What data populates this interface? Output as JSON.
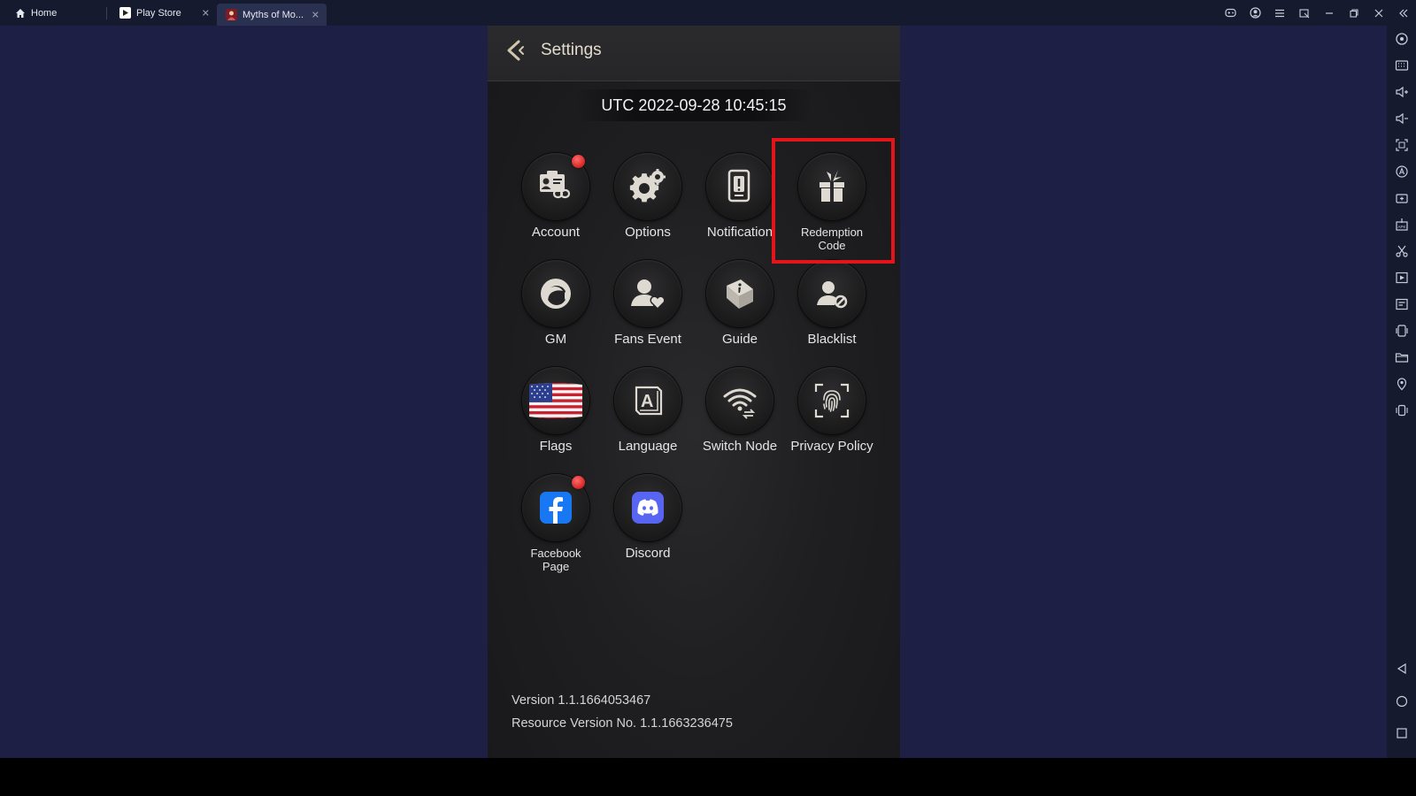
{
  "emulator": {
    "tabs": [
      {
        "label": "Home",
        "icon": "home-icon"
      },
      {
        "label": "Play Store",
        "icon": "play-store-icon"
      },
      {
        "label": "Myths of Mo...",
        "icon": "game-icon",
        "active": true
      }
    ]
  },
  "settings": {
    "title": "Settings",
    "utc": "UTC 2022-09-28 10:45:15",
    "items": [
      {
        "label": "Account",
        "icon": "account-icon",
        "badge": true
      },
      {
        "label": "Options",
        "icon": "gear-icon",
        "badge": false
      },
      {
        "label": "Notification",
        "icon": "notification-icon",
        "badge": false
      },
      {
        "label": "Redemption Code",
        "icon": "gift-icon",
        "badge": false,
        "highlighted": true
      },
      {
        "label": "GM",
        "icon": "headset-icon",
        "badge": false
      },
      {
        "label": "Fans Event",
        "icon": "fans-icon",
        "badge": false
      },
      {
        "label": "Guide",
        "icon": "guide-book-icon",
        "badge": false
      },
      {
        "label": "Blacklist",
        "icon": "blacklist-icon",
        "badge": false
      },
      {
        "label": "Flags",
        "icon": "us-flag-icon",
        "badge": false
      },
      {
        "label": "Language",
        "icon": "language-icon",
        "badge": false
      },
      {
        "label": "Switch Node",
        "icon": "wifi-icon",
        "badge": false
      },
      {
        "label": "Privacy Policy",
        "icon": "fingerprint-icon",
        "badge": false
      },
      {
        "label": "Facebook Page",
        "icon": "facebook-icon",
        "badge": true
      },
      {
        "label": "Discord",
        "icon": "discord-icon",
        "badge": false
      }
    ],
    "version": "Version 1.1.1664053467",
    "resource_version": "Resource Version No. 1.1.1663236475"
  },
  "colors": {
    "highlight": "#e3151b",
    "badge": "#d42525",
    "stage_background": "#1e1f45",
    "facebook": "#1877f2",
    "discord": "#5865f2"
  }
}
